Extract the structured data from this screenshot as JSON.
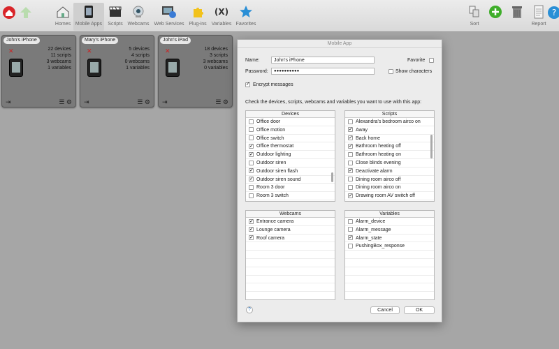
{
  "toolbar": {
    "items": [
      {
        "label": "Homes",
        "icon": "house-icon"
      },
      {
        "label": "Mobile Apps",
        "icon": "mobile-icon",
        "selected": true
      },
      {
        "label": "Scripts",
        "icon": "clapper-icon"
      },
      {
        "label": "Webcams",
        "icon": "webcam-icon"
      },
      {
        "label": "Web Services",
        "icon": "globe-icon"
      },
      {
        "label": "Plug-ins",
        "icon": "puzzle-icon"
      },
      {
        "label": "Variables",
        "icon": "variables-icon"
      },
      {
        "label": "Favorites",
        "icon": "star-icon"
      }
    ],
    "right_items": [
      {
        "label": "Sort",
        "icon": "sort-icon"
      },
      {
        "label": "",
        "icon": "add-icon"
      },
      {
        "label": "",
        "icon": "trash-icon"
      },
      {
        "label": "Report",
        "icon": "report-icon"
      },
      {
        "label": "",
        "icon": "help-icon"
      }
    ],
    "variables_glyph": "(X)"
  },
  "apps": [
    {
      "name": "John's iPhone",
      "devices": "22 devices",
      "scripts": "11 scripts",
      "webcams": "3 webcams",
      "variables": "1 variables"
    },
    {
      "name": "Mary's iPhone",
      "devices": "5 devices",
      "scripts": "4 scripts",
      "webcams": "0 webcams",
      "variables": "1 variables"
    },
    {
      "name": "John's iPad",
      "devices": "18 devices",
      "scripts": "3 scripts",
      "webcams": "3 webcams",
      "variables": "0 variables"
    }
  ],
  "dialog": {
    "title": "Mobile App",
    "name_label": "Name:",
    "name_value": "John's iPhone",
    "password_label": "Password:",
    "password_value": "●●●●●●●●●●",
    "favorite_label": "Favorite",
    "show_chars_label": "Show characters",
    "encrypt_label": "Encrypt messages",
    "instructions": "Check the devices, scripts, webcams and variables you want to use with this app:",
    "devices_header": "Devices",
    "devices": [
      {
        "label": "Office door",
        "checked": false
      },
      {
        "label": "Office motion",
        "checked": false
      },
      {
        "label": "Office switch",
        "checked": false
      },
      {
        "label": "Office thermostat",
        "checked": true
      },
      {
        "label": "Outdoor lighting",
        "checked": true
      },
      {
        "label": "Outdoor siren",
        "checked": false
      },
      {
        "label": "Outdoor siren flash",
        "checked": true
      },
      {
        "label": "Outdoor siren sound",
        "checked": true
      },
      {
        "label": "Room 3 door",
        "checked": false
      },
      {
        "label": "Room 3 switch",
        "checked": false
      }
    ],
    "scripts_header": "Scripts",
    "scripts": [
      {
        "label": "Alexandra's bedroom airco on",
        "checked": false
      },
      {
        "label": "Away",
        "checked": true
      },
      {
        "label": "Back home",
        "checked": true
      },
      {
        "label": "Bathroom heating off",
        "checked": true
      },
      {
        "label": "Bathroom heating on",
        "checked": false
      },
      {
        "label": "Close blinds evening",
        "checked": false
      },
      {
        "label": "Deactivate alarm",
        "checked": true
      },
      {
        "label": "Dining room airco off",
        "checked": false
      },
      {
        "label": "Dining room airco on",
        "checked": false
      },
      {
        "label": "Drawing room AV switch off",
        "checked": true
      }
    ],
    "webcams_header": "Webcams",
    "webcams": [
      {
        "label": "Entrance camera",
        "checked": true
      },
      {
        "label": "Lounge camera",
        "checked": true
      },
      {
        "label": "Roof camera",
        "checked": true
      }
    ],
    "variables_header": "Variables",
    "variables": [
      {
        "label": "Alarm_device",
        "checked": false
      },
      {
        "label": "Alarm_message",
        "checked": false
      },
      {
        "label": "Alarm_state",
        "checked": true
      },
      {
        "label": "PushingBox_response",
        "checked": false
      }
    ],
    "help": "?",
    "cancel": "Cancel",
    "ok": "OK"
  },
  "colors": {
    "accent_red": "#d9252a",
    "add_green": "#3fae2a",
    "star_blue": "#2a8fd6"
  }
}
